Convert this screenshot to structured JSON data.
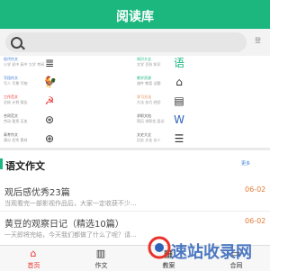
{
  "header": {
    "title": "阅读库"
  },
  "search": {
    "placeholder": ""
  },
  "corner": {
    "label": "登"
  },
  "grid": {
    "items": [
      {
        "title": "现代作文",
        "sub": "小学 初中 高中 大学 考研",
        "icon": "book-icon",
        "glyph": "≣"
      },
      {
        "title": "知识大全",
        "sub": "文学 百科 知识",
        "icon": "yu-character-icon",
        "glyph": "语"
      },
      {
        "title": "写段作文",
        "sub": "写人 写景 写物",
        "icon": "rooster-icon",
        "glyph": "🐓"
      },
      {
        "title": "教学资源",
        "sub": "课件 教案 试题",
        "icon": "graduation-icon",
        "glyph": "⌂"
      },
      {
        "title": "工作范文",
        "sub": "总结 计划 报告",
        "icon": "party-emblem-icon",
        "glyph": "☭"
      },
      {
        "title": "学习方法",
        "sub": "方法 技巧 经验",
        "icon": "book-stack-icon",
        "glyph": "▤"
      },
      {
        "title": "合同范文",
        "sub": "劳动 租赁 买卖",
        "icon": "seal-icon",
        "glyph": "⊛"
      },
      {
        "title": "求职文档",
        "sub": "简历 求职信 面试",
        "icon": "word-doc-icon",
        "glyph": "W"
      },
      {
        "title": "高考作文",
        "sub": "满分 优秀 素材",
        "icon": "emblem-icon",
        "glyph": "⊕"
      },
      {
        "title": "文史大全",
        "sub": "历史 文化 名人",
        "icon": "scroll-icon",
        "glyph": "☰"
      }
    ]
  },
  "section": {
    "title": "语文作文",
    "more": "更多"
  },
  "articles": [
    {
      "title": "观后感优秀23篇",
      "date": "06-02",
      "excerpt": "当观看完一部影视作品后，大家一定收获不少..."
    },
    {
      "title": "黄豆的观察日记（精选10篇）",
      "date": "06-02",
      "excerpt": "一天即将完结，今天我们都做了什么了呢？请..."
    }
  ],
  "tabbar": {
    "tabs": [
      {
        "label": "首页",
        "icon": "home-icon",
        "glyph": "⌂",
        "active": true
      },
      {
        "label": "作文",
        "icon": "book-icon",
        "glyph": "▥",
        "active": false
      },
      {
        "label": "教案",
        "icon": "document-icon",
        "glyph": "▦",
        "active": false
      },
      {
        "label": "合同",
        "icon": "paper-icon",
        "glyph": "▭",
        "active": false
      }
    ]
  },
  "watermark": {
    "text": "速站收录网"
  },
  "colors": {
    "brand": "#1cb77f",
    "active": "#e8322b",
    "date": "#e07b39"
  }
}
